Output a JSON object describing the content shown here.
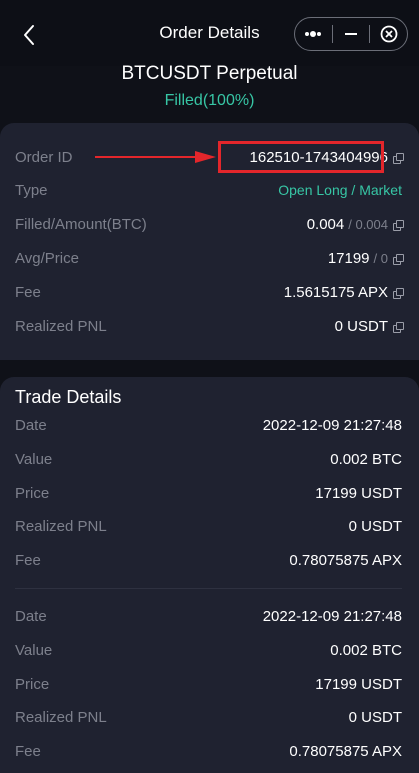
{
  "nav": {
    "title": "Order Details"
  },
  "header": {
    "pair": "BTCUSDT Perpetual",
    "status": "Filled(100%)"
  },
  "order": {
    "order_id_label": "Order ID",
    "order_id_value": "162510-1743404996",
    "type_label": "Type",
    "type_value": "Open Long / Market",
    "filled_label": "Filled/Amount(BTC)",
    "filled_value": "0.004",
    "filled_amount": "/ 0.004",
    "avg_label": "Avg/Price",
    "avg_value": "17199",
    "avg_price": "/ 0",
    "fee_label": "Fee",
    "fee_value": "1.5615175 APX",
    "pnl_label": "Realized PNL",
    "pnl_value": "0 USDT"
  },
  "trades": {
    "title": "Trade Details",
    "items": [
      {
        "date_label": "Date",
        "date": "2022-12-09 21:27:48",
        "value_label": "Value",
        "value": "0.002 BTC",
        "price_label": "Price",
        "price": "17199 USDT",
        "pnl_label": "Realized PNL",
        "pnl": "0 USDT",
        "fee_label": "Fee",
        "fee": "0.78075875 APX"
      },
      {
        "date_label": "Date",
        "date": "2022-12-09 21:27:48",
        "value_label": "Value",
        "value": "0.002 BTC",
        "price_label": "Price",
        "price": "17199 USDT",
        "pnl_label": "Realized PNL",
        "pnl": "0 USDT",
        "fee_label": "Fee",
        "fee": "0.78075875 APX"
      }
    ]
  },
  "colors": {
    "accent": "#37c6a5",
    "background": "#0f1118",
    "card": "#1f2230",
    "annotation": "#e3262b"
  }
}
